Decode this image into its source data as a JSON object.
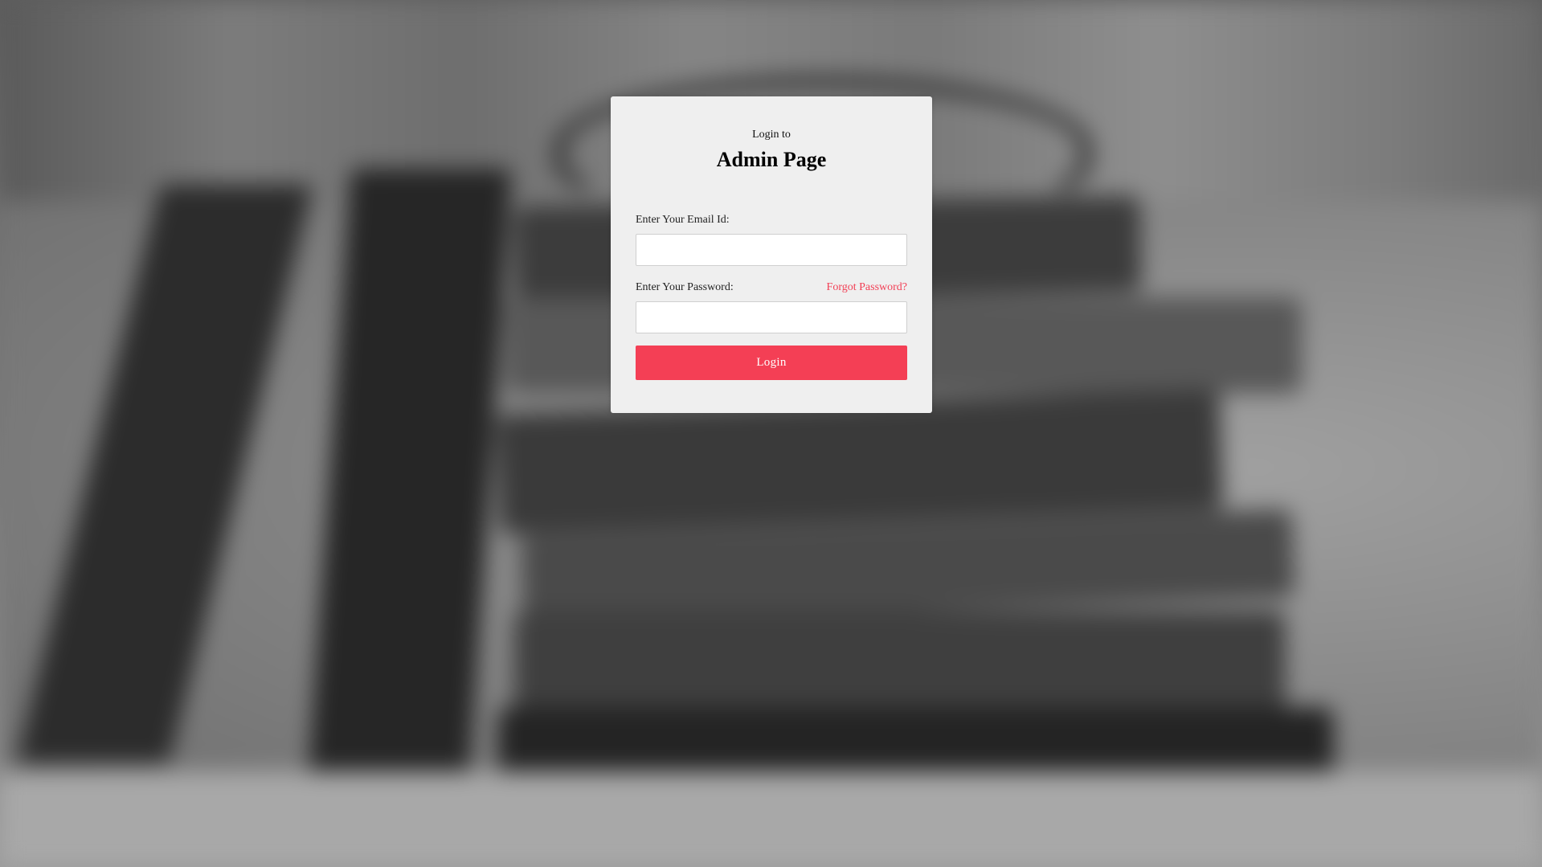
{
  "login": {
    "subtitle": "Login to",
    "title": "Admin Page",
    "email_label": "Enter Your Email Id:",
    "email_value": "",
    "password_label": "Enter Your Password:",
    "password_value": "",
    "forgot_password": "Forgot Password?",
    "login_button": "Login"
  },
  "colors": {
    "accent": "#f43f55",
    "card_background": "#efefef"
  }
}
